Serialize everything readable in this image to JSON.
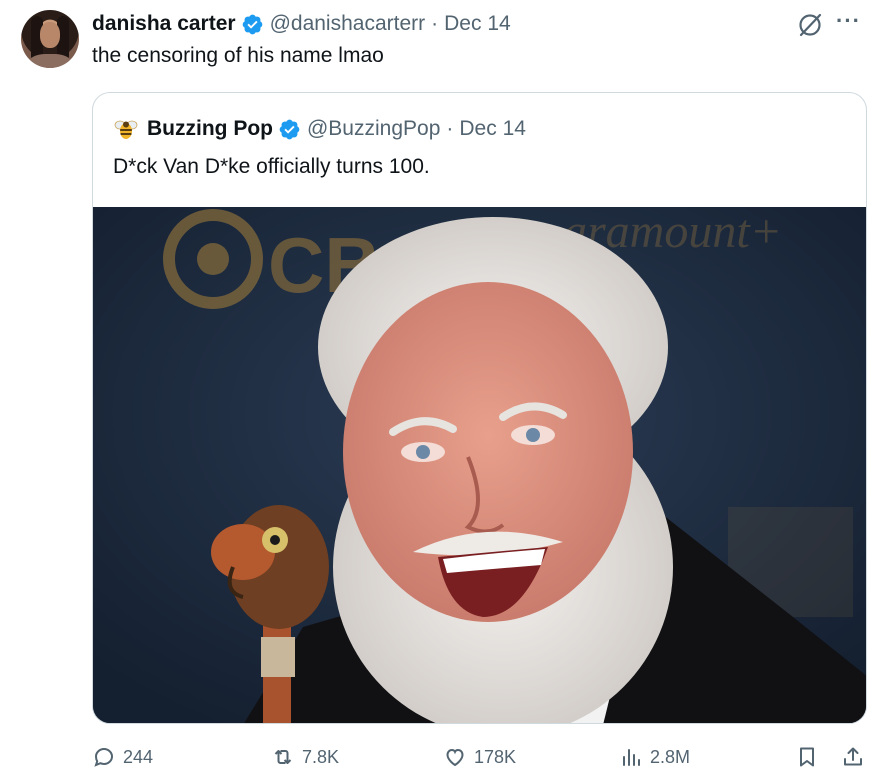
{
  "author": {
    "name": "danisha carter",
    "handle": "@danishacarterr",
    "separator": "·",
    "date": "Dec 14",
    "text": "the censoring of his name lmao"
  },
  "quoted": {
    "name": "Buzzing Pop",
    "handle": "@BuzzingPop",
    "separator": "·",
    "date": "Dec 14",
    "text": "D*ck Van D*ke officially turns 100.",
    "image_backdrop": {
      "logo": "CBS"
    }
  },
  "actions": {
    "replies": "244",
    "reposts": "7.8K",
    "likes": "178K",
    "views": "2.8M"
  },
  "colors": {
    "verified": "#1d9bf0",
    "muted": "#536471",
    "border": "#cfd9de"
  },
  "icons": [
    "grok-icon",
    "more-icon",
    "verified-icon",
    "reply-icon",
    "repost-icon",
    "like-icon",
    "views-icon",
    "bookmark-icon",
    "share-icon"
  ]
}
